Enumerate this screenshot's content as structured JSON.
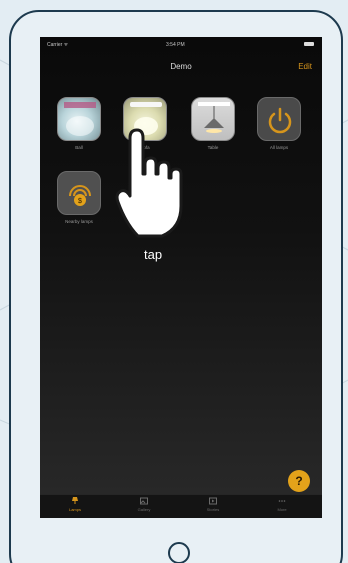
{
  "status": {
    "carrier": "Carrier ᯤ",
    "time": "3:54 PM"
  },
  "navbar": {
    "title": "Demo",
    "edit_label": "Edit"
  },
  "lamps": [
    {
      "name": "Ball",
      "icon": "ball-lamp-icon"
    },
    {
      "name": "Sofa",
      "icon": "sofa-lamp-icon"
    },
    {
      "name": "Table",
      "icon": "table-lamp-icon"
    },
    {
      "name": "All lamps",
      "icon": "power-icon"
    },
    {
      "name": "Nearby lamps",
      "icon": "nearby-icon"
    }
  ],
  "gesture": {
    "label": "tap",
    "icon": "tapping-hand-icon"
  },
  "help": {
    "label": "?"
  },
  "tabbar": {
    "items": [
      {
        "label": "Lamps",
        "icon": "lamp-icon",
        "active": true
      },
      {
        "label": "Gallery",
        "icon": "gallery-icon",
        "active": false
      },
      {
        "label": "Stories",
        "icon": "stories-icon",
        "active": false
      },
      {
        "label": "More",
        "icon": "more-icon",
        "active": false
      }
    ]
  },
  "colors": {
    "accent": "#d6951c",
    "frame": "#1d3a4e",
    "help": "#e3a21a"
  }
}
